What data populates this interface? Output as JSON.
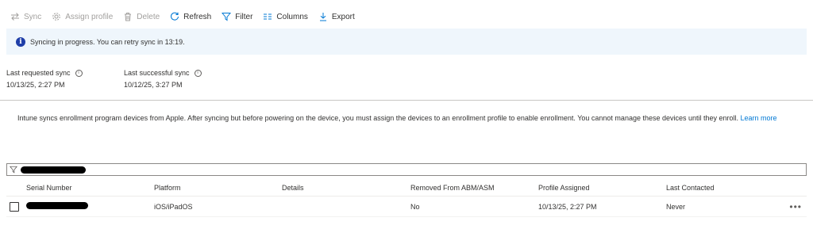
{
  "toolbar": {
    "sync": {
      "label": "Sync",
      "icon": "sync-icon",
      "enabled": false
    },
    "assign_profile": {
      "label": "Assign profile",
      "icon": "gear-icon",
      "enabled": false
    },
    "delete": {
      "label": "Delete",
      "icon": "trash-icon",
      "enabled": false
    },
    "refresh": {
      "label": "Refresh",
      "icon": "refresh-icon",
      "enabled": true
    },
    "filter": {
      "label": "Filter",
      "icon": "filter-icon",
      "enabled": true
    },
    "columns": {
      "label": "Columns",
      "icon": "columns-icon",
      "enabled": true
    },
    "export": {
      "label": "Export",
      "icon": "download-icon",
      "enabled": true
    }
  },
  "banner": {
    "text": "Syncing in progress. You can retry sync in 13:19.",
    "icon": "info-icon",
    "background": "#eff6fc"
  },
  "sync_info": {
    "last_requested": {
      "label": "Last requested sync",
      "value": "10/13/25, 2:27 PM"
    },
    "last_successful": {
      "label": "Last successful sync",
      "value": "10/12/25, 3:27 PM"
    }
  },
  "description": {
    "text": "Intune syncs enrollment program devices from Apple. After syncing but before powering on the device, you must assign the devices to an enrollment profile to enable enrollment. You cannot manage these devices until they enroll. ",
    "link": "Learn more"
  },
  "filter": {
    "icon": "filter-icon",
    "value_redacted": true
  },
  "table": {
    "columns": [
      "Serial Number",
      "Platform",
      "Details",
      "Removed From ABM/ASM",
      "Profile Assigned",
      "Last Contacted"
    ],
    "rows": [
      {
        "serial_redacted": true,
        "platform": "iOS/iPadOS",
        "details": "",
        "removed": "No",
        "profile_assigned": "10/13/25, 2:27 PM",
        "last_contacted": "Never",
        "more": "•••"
      }
    ]
  },
  "colors": {
    "accent": "#0078d4",
    "disabled": "#a19f9d",
    "info_icon": "#1f3ea8"
  }
}
